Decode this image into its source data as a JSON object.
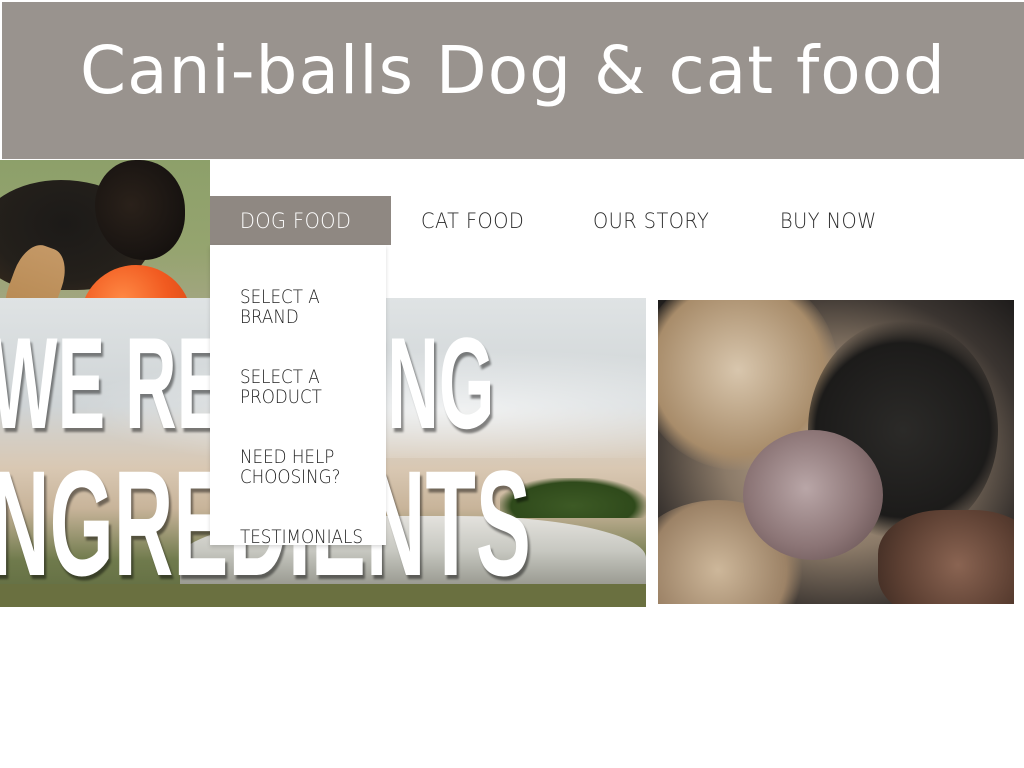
{
  "site": {
    "title": "Cani-balls Dog & cat food"
  },
  "nav": {
    "items": [
      {
        "label": "DOG FOOD",
        "active": true
      },
      {
        "label": "CAT FOOD",
        "active": false
      },
      {
        "label": "OUR STORY",
        "active": false
      },
      {
        "label": "BUY NOW",
        "active": false
      }
    ]
  },
  "dropdown": {
    "items": [
      {
        "label": "SELECT A\nBRAND"
      },
      {
        "label": "SELECT A\nPRODUCT"
      },
      {
        "label": "NEED HELP\nCHOOSING?"
      },
      {
        "label": "TESTIMONIALS"
      }
    ]
  },
  "banner": {
    "line1": "WE RE  OWING",
    "line2": "NGREDIENTS"
  },
  "colors": {
    "header_bg": "#99938e",
    "nav_active_bg": "#8f8882",
    "text": "#222222"
  }
}
